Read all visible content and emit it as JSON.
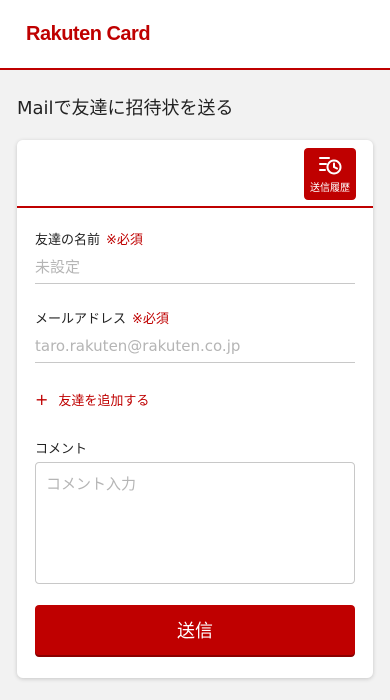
{
  "header": {
    "logo_text": "Rakuten Card"
  },
  "page": {
    "title": "Mailで友達に招待状を送る"
  },
  "history_button": {
    "label": "送信履歴",
    "icon": "history-list-icon"
  },
  "form": {
    "name_field": {
      "label": "友達の名前",
      "required": "※必須",
      "placeholder": "未設定",
      "value": ""
    },
    "email_field": {
      "label": "メールアドレス",
      "required": "※必須",
      "placeholder": "taro.rakuten@rakuten.co.jp",
      "value": ""
    },
    "add_friend": {
      "icon": "+",
      "label": "友達を追加する"
    },
    "comment_field": {
      "label": "コメント",
      "placeholder": "コメント入力",
      "value": ""
    },
    "submit_label": "送信"
  },
  "colors": {
    "brand": "#bf0000",
    "background": "#f2f2f2",
    "card": "#ffffff"
  }
}
